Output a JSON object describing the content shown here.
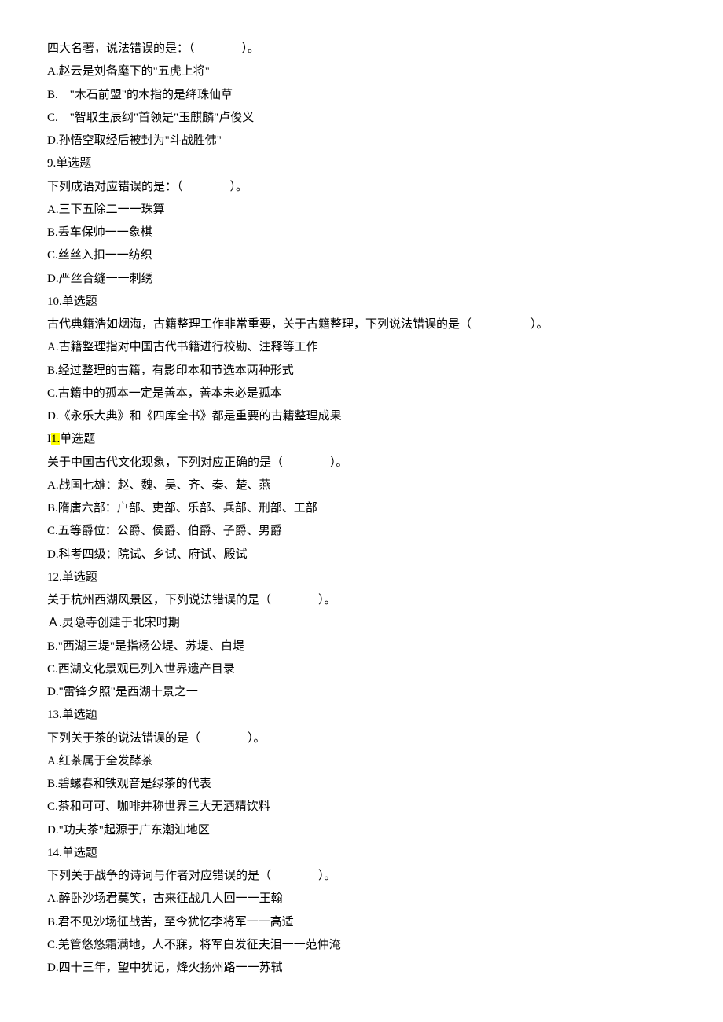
{
  "preamble": {
    "stem": "四大名著，说法错误的是：（　　　　）。",
    "options": {
      "A": "A.赵云是刘备麾下的\"五虎上将\"",
      "B": "B.　\"木石前盟\"的木指的是绛珠仙草",
      "C": "C.　\"智取生辰纲\"首领是\"玉麒麟\"卢俊义",
      "D": "D.孙悟空取经后被封为\"斗战胜佛\""
    }
  },
  "questions": [
    {
      "num": "9.单选题",
      "stem": "下列成语对应错误的是：（　　　　）。",
      "options": {
        "A": "A.三下五除二一一珠算",
        "B": "B.丢车保帅一一象棋",
        "C": "C.丝丝入扣一一纺织",
        "D": "D.严丝合缝一一刺绣"
      }
    },
    {
      "num": "10.单选题",
      "stem": "古代典籍浩如烟海，古籍整理工作非常重要，关于古籍整理，下列说法错误的是（　　　　　）。",
      "options": {
        "A": "A.古籍整理指对中国古代书籍进行校勘、注释等工作",
        "B": "B.经过整理的古籍，有影印本和节选本两种形式",
        "C": "C.古籍中的孤本一定是善本，善本未必是孤本",
        "D": "D.《永乐大典》和《四库全书》都是重要的古籍整理成果"
      }
    },
    {
      "num_prefix": "I",
      "num_highlight": "1.",
      "num_suffix": "单选题",
      "stem": "关于中国古代文化现象，下列对应正确的是（　　　　）。",
      "options": {
        "A": "A.战国七雄：赵、魏、吴、齐、秦、楚、燕",
        "B": "B.隋唐六部：户部、吏部、乐部、兵部、刑部、工部",
        "C": "C.五等爵位：公爵、侯爵、伯爵、子爵、男爵",
        "D": "D.科考四级：院试、乡试、府试、殿试"
      }
    },
    {
      "num": "12.单选题",
      "stem": "关于杭州西湖风景区，下列说法错误的是（　　　　）。",
      "options": {
        "A": "Ａ.灵隐寺创建于北宋时期",
        "B": "B.\"西湖三堤\"是指杨公堤、苏堤、白堤",
        "C": "C.西湖文化景观已列入世界遗产目录",
        "D": "D.\"雷锋夕照\"是西湖十景之一"
      }
    },
    {
      "num": "13.单选题",
      "stem": "下列关于茶的说法错误的是（　　　　）。",
      "options": {
        "A": "A.红茶属于全发酵茶",
        "B": "B.碧螺春和铁观音是绿茶的代表",
        "C": "C.茶和可可、咖啡并称世界三大无酒精饮料",
        "D": "D.\"功夫茶\"起源于广东潮汕地区"
      }
    },
    {
      "num": "14.单选题",
      "stem": "下列关于战争的诗词与作者对应错误的是（　　　　）。",
      "options": {
        "A": "A.醉卧沙场君莫笑，古来征战几人回一一王翰",
        "B": "B.君不见沙场征战苦，至今犹忆李将军一一高适",
        "C": "C.羌管悠悠霜满地，人不寐，将军白发征夫泪一一范仲淹",
        "D": "D.四十三年，望中犹记，烽火扬州路一一苏轼"
      }
    }
  ]
}
